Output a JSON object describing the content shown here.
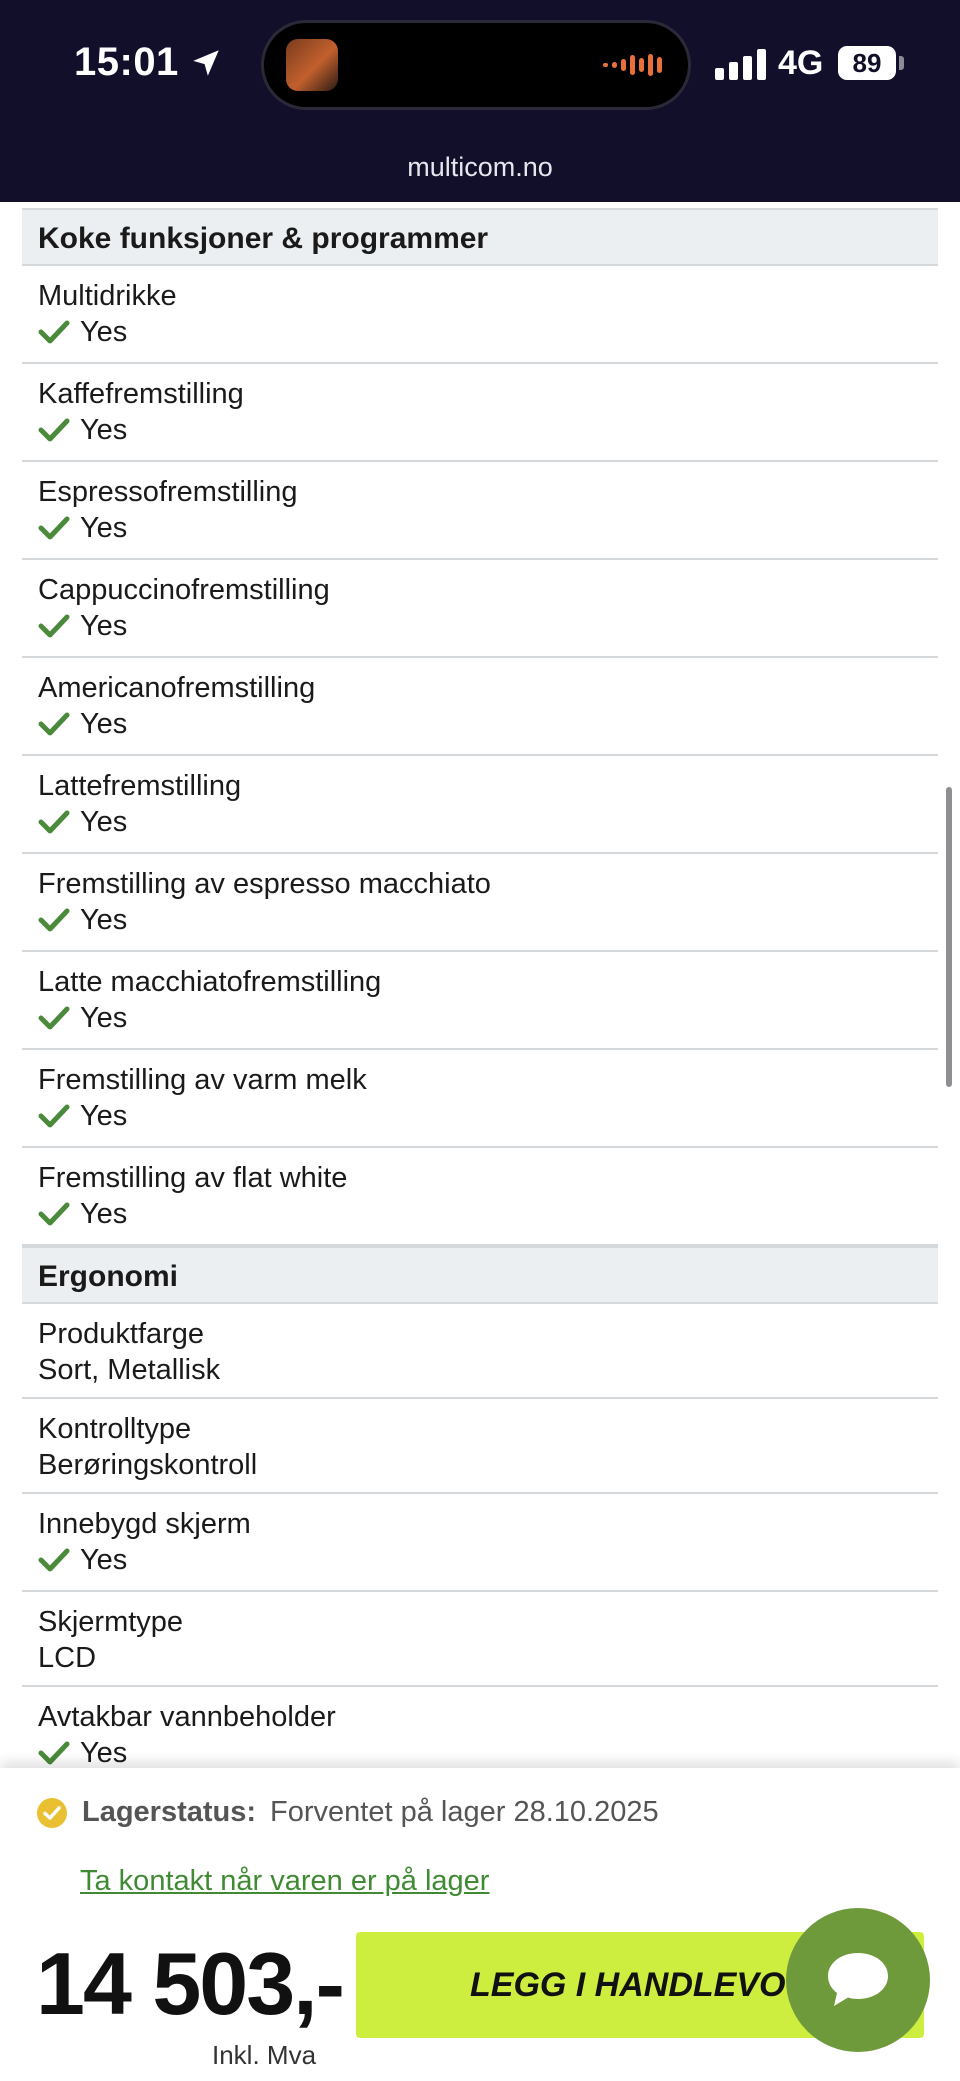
{
  "status": {
    "time": "15:01",
    "network": "4G",
    "battery": "89",
    "url": "multicom.no"
  },
  "sections": [
    {
      "title": "Koke funksjoner & programmer",
      "rows": [
        {
          "label": "Multidrikke",
          "value": "Yes",
          "check": true
        },
        {
          "label": "Kaffefremstilling",
          "value": "Yes",
          "check": true
        },
        {
          "label": "Espressofremstilling",
          "value": "Yes",
          "check": true
        },
        {
          "label": "Cappuccinofremstilling",
          "value": "Yes",
          "check": true
        },
        {
          "label": "Americanofremstilling",
          "value": "Yes",
          "check": true
        },
        {
          "label": "Lattefremstilling",
          "value": "Yes",
          "check": true
        },
        {
          "label": "Fremstilling av espresso macchiato",
          "value": "Yes",
          "check": true
        },
        {
          "label": "Latte macchiatofremstilling",
          "value": "Yes",
          "check": true
        },
        {
          "label": "Fremstilling av varm melk",
          "value": "Yes",
          "check": true
        },
        {
          "label": "Fremstilling av flat white",
          "value": "Yes",
          "check": true
        }
      ]
    },
    {
      "title": "Ergonomi",
      "rows": [
        {
          "label": "Produktfarge",
          "value": "Sort, Metallisk",
          "check": false
        },
        {
          "label": "Kontrolltype",
          "value": "Berøringskontroll",
          "check": false
        },
        {
          "label": "Innebygd skjerm",
          "value": "Yes",
          "check": true
        },
        {
          "label": "Skjermtype",
          "value": "LCD",
          "check": false
        },
        {
          "label": "Avtakbar vannbeholder",
          "value": "Yes",
          "check": true
        }
      ]
    }
  ],
  "stock": {
    "label": "Lagerstatus:",
    "value": "Forventet på lager 28.10.2025",
    "notify_link": "Ta kontakt når varen er på lager"
  },
  "price": {
    "amount": "14 503,-",
    "vat_note": "Inkl. Mva"
  },
  "cart_button": "LEGG I HANDLEVOGN",
  "colors": {
    "status_bar": "#120f2a",
    "check_green": "#4a8a3a",
    "cta": "#cdee3f",
    "chat": "#6e9a3c",
    "stock_icon": "#e9c032"
  }
}
